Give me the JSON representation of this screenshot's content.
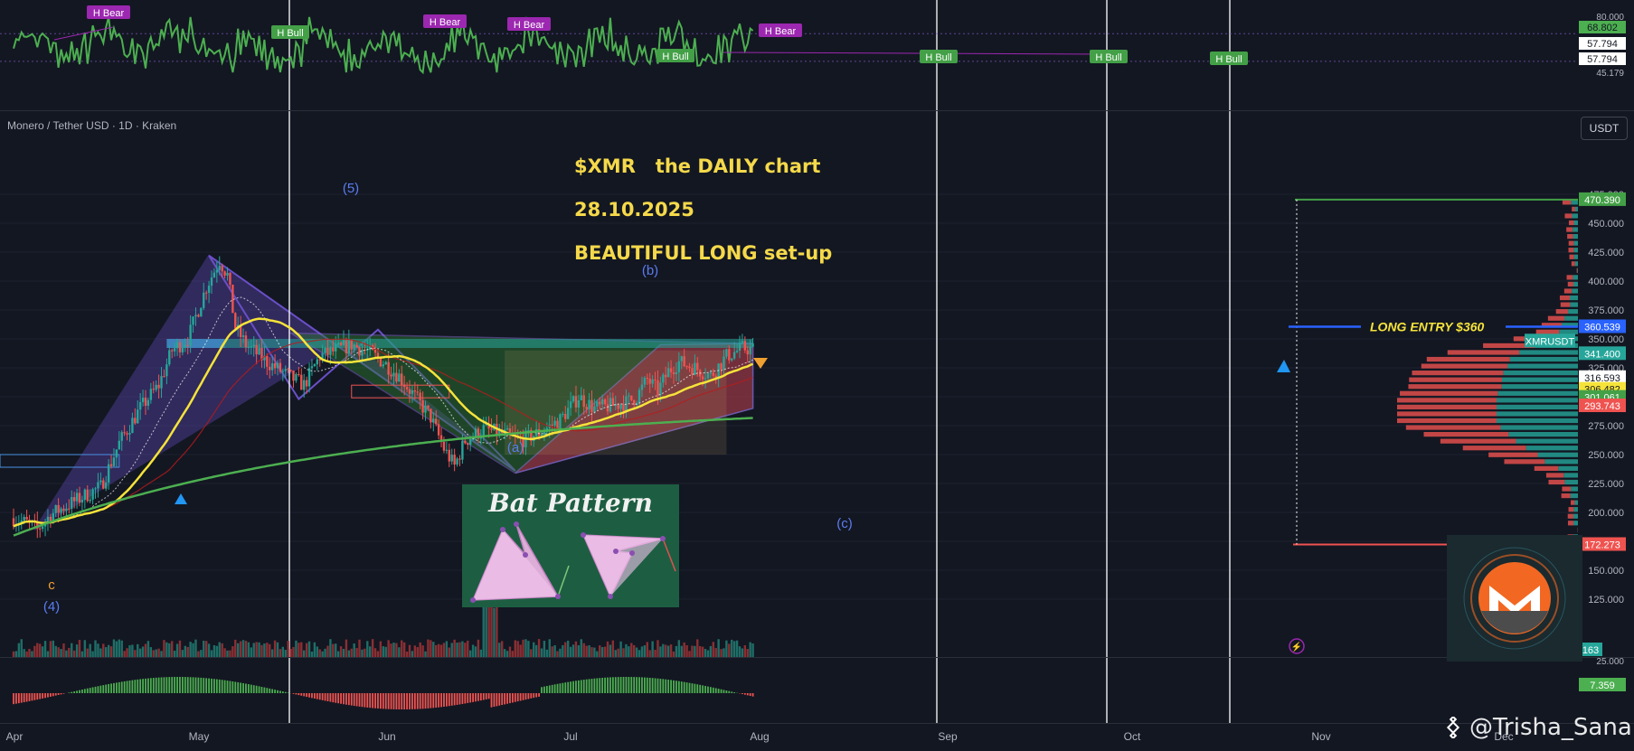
{
  "header": {
    "symbol_label": "Monero / Tether USD · 1D · Kraken",
    "currency_button": "USDT"
  },
  "annotations": {
    "title_line1": "$XMR   the DAILY chart",
    "title_line2": "28.10.2025",
    "title_line3": "BEAUTIFUL LONG set-up",
    "long_entry": "LONG ENTRY $360",
    "bat_pattern": "Bat Pattern",
    "watermark": "@Trisha_Sana",
    "wave_labels": [
      {
        "text": "(5)",
        "color": "#5b7cf0"
      },
      {
        "text": "(b)",
        "color": "#5b7cf0"
      },
      {
        "text": "(a)",
        "color": "#5b7cf0"
      },
      {
        "text": "(c)",
        "color": "#5b7cf0"
      },
      {
        "text": "(4)",
        "color": "#5b7cf0"
      },
      {
        "text": "c",
        "color": "#f0a030"
      }
    ]
  },
  "rsi_pane": {
    "scale_labels": [
      "80.000",
      "45.179"
    ],
    "value_badges": [
      {
        "text": "68.802",
        "color": "#4caf50"
      },
      {
        "text": "57.794",
        "color": "#ffffff"
      },
      {
        "text": "57.794",
        "color": "#ffffff"
      }
    ],
    "divergence_labels": [
      {
        "text": "H Bear",
        "color": "#9c27b0"
      },
      {
        "text": "H Bull",
        "color": "#43a047"
      },
      {
        "text": "H Bear",
        "color": "#9c27b0"
      },
      {
        "text": "H Bear",
        "color": "#9c27b0"
      },
      {
        "text": "H Bull",
        "color": "#43a047"
      },
      {
        "text": "H Bear",
        "color": "#9c27b0"
      },
      {
        "text": "H Bull",
        "color": "#43a047"
      },
      {
        "text": "H Bull",
        "color": "#43a047"
      },
      {
        "text": "H Bull",
        "color": "#43a047"
      }
    ]
  },
  "price_axis": {
    "ticks": [
      "475.000",
      "450.000",
      "425.000",
      "400.000",
      "375.000",
      "350.000",
      "325.000",
      "300.000",
      "275.000",
      "250.000",
      "225.000",
      "200.000",
      "175.000",
      "150.000",
      "125.000"
    ],
    "badges": [
      {
        "text": "470.390",
        "bg": "#43a047",
        "fg": "#ffffff"
      },
      {
        "text": "360.539",
        "bg": "#2962ff",
        "fg": "#ffffff"
      },
      {
        "text": "XMRUSDT",
        "bg": "#26a69a",
        "fg": "#ffffff"
      },
      {
        "text": "341.400",
        "bg": "#26a69a",
        "fg": "#ffffff"
      },
      {
        "text": "316.593",
        "bg": "#ffffff",
        "fg": "#131722"
      },
      {
        "text": "306.482",
        "bg": "#f5e33a",
        "fg": "#131722"
      },
      {
        "text": "301.061",
        "bg": "#43a047",
        "fg": "#ffffff"
      },
      {
        "text": "293.743",
        "bg": "#ef5350",
        "fg": "#ffffff"
      },
      {
        "text": "172.273",
        "bg": "#ef5350",
        "fg": "#ffffff"
      },
      {
        "text": "163",
        "bg": "#26a69a",
        "fg": "#ffffff"
      }
    ]
  },
  "osc_pane": {
    "scale_labels": [
      "25.000"
    ],
    "value_badge": {
      "text": "7.359",
      "bg": "#4caf50"
    }
  },
  "time_axis": {
    "labels": [
      "Apr",
      "May",
      "Jun",
      "Jul",
      "Aug",
      "Sep",
      "Oct",
      "Nov",
      "Dec"
    ]
  },
  "colors": {
    "background": "#131722",
    "bull": "#26a69a",
    "bear": "#ef5350",
    "ma_yellow": "#f5e33a",
    "ma_green": "#4caf50",
    "rsi_line": "#4caf50",
    "pattern_purple": "#6a4fc8",
    "title_yellow": "#f5d94a"
  },
  "chart_data": {
    "type": "candlestick",
    "pair": "XMR/USDT",
    "timeframe": "1D",
    "price_range": [
      110,
      480
    ],
    "levels": {
      "target": 470.39,
      "long_entry": 360.539,
      "last_price": 341.4,
      "stop": 172.273
    },
    "moving_averages": [
      {
        "value": 316.593,
        "color": "#ffffff"
      },
      {
        "value": 306.482,
        "color": "#f5e33a"
      },
      {
        "value": 301.061,
        "color": "#4caf50"
      },
      {
        "value": 293.743,
        "color": "#ef5350"
      }
    ],
    "wave_points": [
      {
        "label": "(4)",
        "date": "2025-04-09",
        "price": 185
      },
      {
        "label": "(5)",
        "date": "2025-05-24",
        "price": 420
      },
      {
        "label": "(a)",
        "date": "2025-06-20",
        "price": 298
      },
      {
        "label": "(b)",
        "date": "2025-07-06",
        "price": 358
      },
      {
        "label": "(c)",
        "date": "2025-08-14",
        "price": 233
      }
    ],
    "volume_last": 163,
    "oscillator_last": 7.359
  }
}
